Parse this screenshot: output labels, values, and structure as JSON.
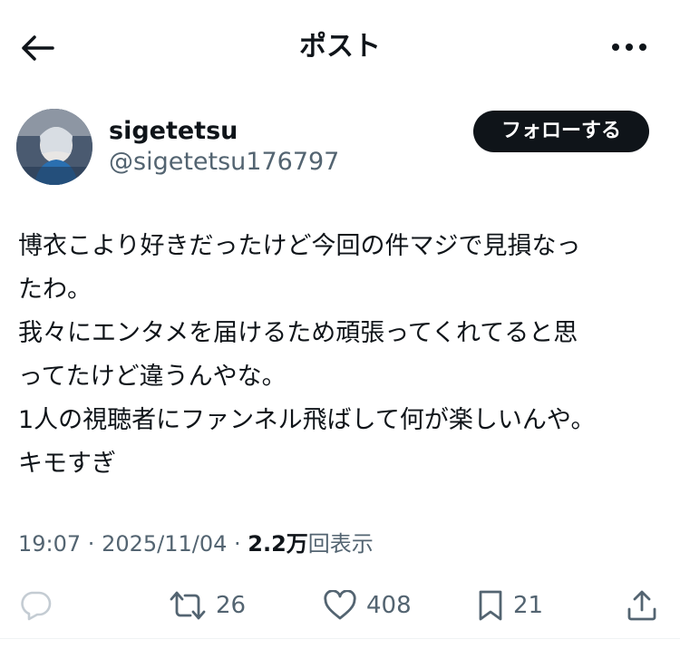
{
  "header": {
    "title": "ポスト"
  },
  "author": {
    "display_name": "sigetetsu",
    "handle": "@sigetetsu176797",
    "follow_label": "フォローする"
  },
  "post": {
    "lines": [
      "博衣こより好きだったけど今回の件マジで見損なっ",
      "たわ。",
      "我々にエンタメを届けるため頑張ってくれてると思",
      "ってたけど違うんやな。",
      "1人の視聴者にファンネル飛ばして何が楽しいんや。",
      "キモすぎ"
    ]
  },
  "meta": {
    "time": "19:07",
    "separator": " · ",
    "date": "2025/11/04",
    "views_count": "2.2万",
    "views_label": "回表示"
  },
  "actions": {
    "repost_count": "26",
    "like_count": "408",
    "bookmark_count": "21"
  },
  "colors": {
    "text": "#0f1419",
    "secondary": "#536471",
    "icon": "#536471",
    "follow_bg": "#0f1419"
  },
  "icons": {
    "back": "arrow-left-icon",
    "more": "more-horizontal-icon",
    "reply": "reply-icon",
    "repost": "repost-icon",
    "like": "heart-icon",
    "bookmark": "bookmark-icon",
    "share": "share-icon"
  }
}
